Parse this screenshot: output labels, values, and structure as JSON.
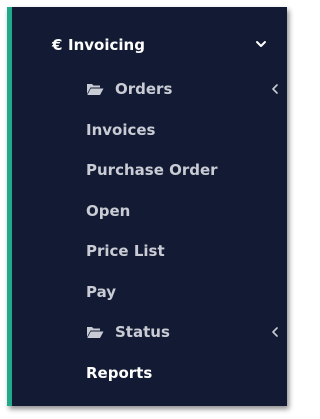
{
  "menu": {
    "header": {
      "currency_symbol": "€",
      "title": "Invoicing",
      "chevron_icon": "chevron-down-icon"
    },
    "items": [
      {
        "label": "Orders",
        "icon": "folder-open-icon",
        "has_submenu": true
      },
      {
        "label": "Invoices"
      },
      {
        "label": "Purchase Order"
      },
      {
        "label": "Open"
      },
      {
        "label": "Price List"
      },
      {
        "label": "Pay"
      },
      {
        "label": "Status",
        "icon": "folder-open-icon",
        "has_submenu": true
      },
      {
        "label": "Reports",
        "active": true
      }
    ]
  },
  "colors": {
    "background": "#131a33",
    "accent_border": "#22a98a",
    "text": "#c9ccd4",
    "active_text": "#ffffff"
  }
}
